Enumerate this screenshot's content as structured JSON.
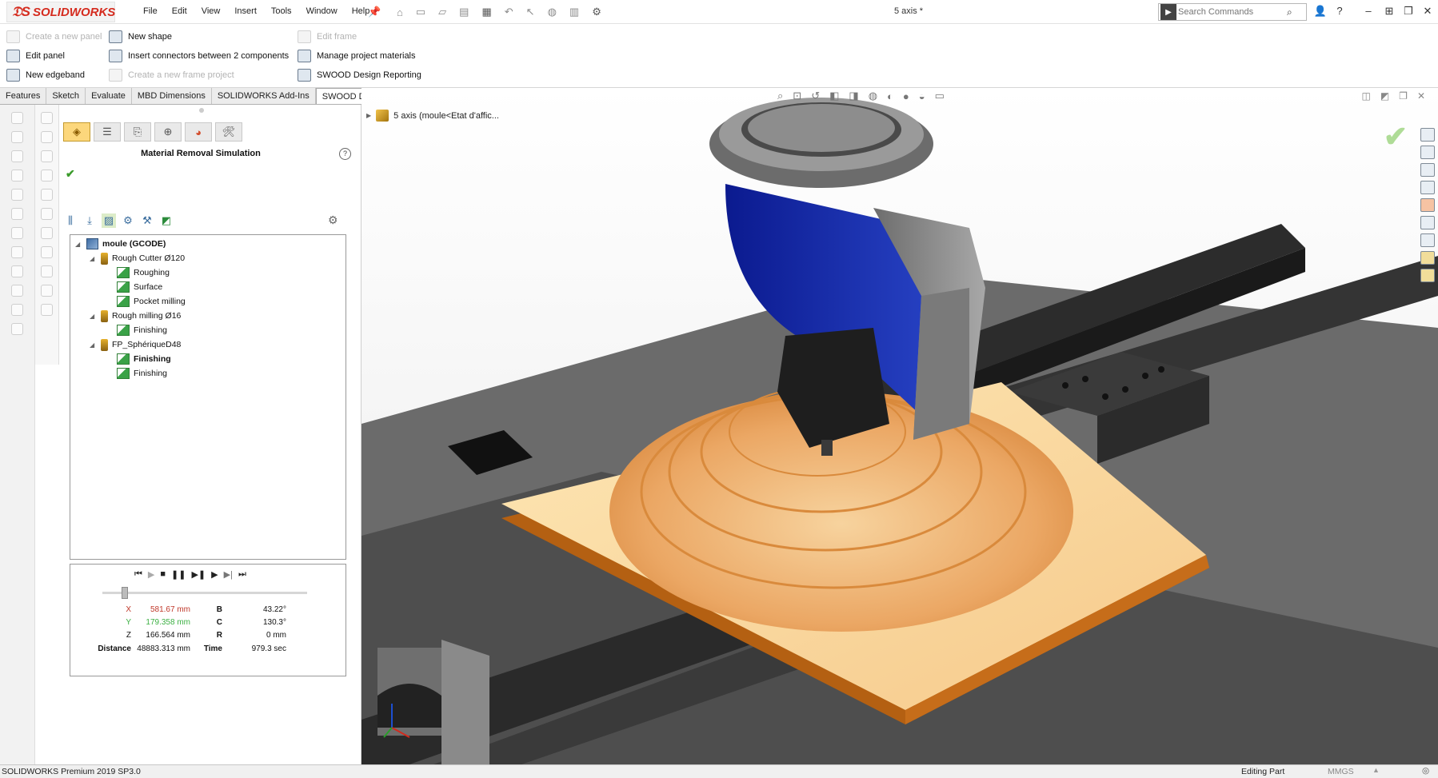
{
  "app": {
    "name": "SOLIDWORKS",
    "doc_title": "5 axis *"
  },
  "menu": [
    "File",
    "Edit",
    "View",
    "Insert",
    "Tools",
    "Window",
    "Help"
  ],
  "search": {
    "placeholder": "Search Commands"
  },
  "commands": {
    "col1": [
      {
        "label": "Create a new panel",
        "enabled": false
      },
      {
        "label": "Edit panel",
        "enabled": true
      },
      {
        "label": "New edgeband",
        "enabled": true
      }
    ],
    "col2": [
      {
        "label": "New shape",
        "enabled": true
      },
      {
        "label": "Insert connectors between 2 components",
        "enabled": true
      },
      {
        "label": "Create a new frame project",
        "enabled": false
      }
    ],
    "col3": [
      {
        "label": "Edit frame",
        "enabled": false
      },
      {
        "label": "Manage project materials",
        "enabled": true
      },
      {
        "label": "SWOOD Design Reporting",
        "enabled": true
      }
    ]
  },
  "tabs": [
    "Features",
    "Sketch",
    "Evaluate",
    "MBD Dimensions",
    "SOLIDWORKS Add-Ins",
    "SWOOD Design"
  ],
  "active_tab": "SWOOD Design",
  "property_manager": {
    "title": "Material Removal Simulation",
    "help": "?",
    "tree": {
      "root": "moule (GCODE)",
      "tools": [
        {
          "name": "Rough Cutter Ø120",
          "ops": [
            "Roughing",
            "Surface",
            "Pocket milling"
          ]
        },
        {
          "name": "Rough milling Ø16",
          "ops": [
            "Finishing"
          ]
        },
        {
          "name": "FP_SphériqueD48",
          "ops": [
            "Finishing",
            "Finishing"
          ]
        }
      ]
    }
  },
  "playback": {
    "controls": [
      "⏮",
      "▶",
      "■",
      "❚❚",
      "▶❚",
      "▶",
      "▶|",
      "⏭"
    ],
    "progress": 0.11,
    "readouts": [
      {
        "label": "X",
        "value": "581.67 mm",
        "label2": "B",
        "value2": "43.22°"
      },
      {
        "label": "Y",
        "value": "179.358 mm",
        "label2": "C",
        "value2": "130.3°"
      },
      {
        "label": "Z",
        "value": "166.564 mm",
        "label2": "R",
        "value2": "0 mm"
      },
      {
        "label": "Distance",
        "value": "48883.313 mm",
        "label2": "Time",
        "value2": "979.3 sec"
      }
    ],
    "colors": {
      "x": "#c0392b",
      "y": "#3cb043",
      "z": "#222222"
    }
  },
  "viewport": {
    "tree_label": "5 axis  (moule<Etat d'affic..."
  },
  "status": {
    "left": "SOLIDWORKS Premium 2019 SP3.0",
    "mode": "Editing Part",
    "units": "MMGS"
  }
}
